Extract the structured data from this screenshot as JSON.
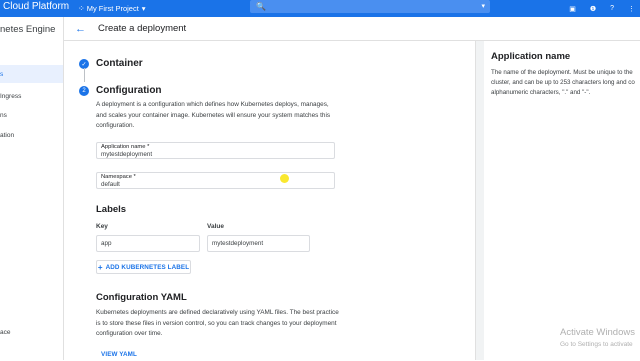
{
  "topbar": {
    "app_title": "Cloud Platform",
    "project_label": "My First Project",
    "icons": [
      "menu-icon",
      "project-dots-icon",
      "dropdown-icon",
      "search-icon",
      "search-dropdown-icon",
      "terminal-icon",
      "notifications-icon",
      "help-icon",
      "more-icon"
    ]
  },
  "sidebar": {
    "title": "netes Engine",
    "items": [
      {
        "label": "s",
        "active": true
      },
      {
        "label": "Ingress",
        "active": false
      },
      {
        "label": "ns",
        "active": false
      },
      {
        "label": "ation",
        "active": false
      },
      {
        "label": "ace",
        "active": false
      }
    ]
  },
  "header": {
    "title": "Create a deployment"
  },
  "steps": {
    "container": {
      "title": "Container"
    },
    "configuration": {
      "number": "2",
      "title": "Configuration",
      "description": "A deployment is a configuration which defines how Kubernetes deploys, manages, and scales your container image. Kubernetes will ensure your system matches this configuration.",
      "app_name": {
        "label": "Application name *",
        "value": "mytestdeployment"
      },
      "namespace": {
        "label": "Namespace *",
        "value": "default"
      }
    }
  },
  "labels": {
    "title": "Labels",
    "key_header": "Key",
    "value_header": "Value",
    "key": "app",
    "value": "mytestdeployment",
    "add_button": "ADD KUBERNETES LABEL"
  },
  "yaml": {
    "title": "Configuration YAML",
    "description": "Kubernetes deployments are defined declaratively using YAML files. The best practice is to store these files in version control, so you can track changes to your deployment configuration over time.",
    "view_button": "VIEW YAML"
  },
  "help_panel": {
    "title": "Application name",
    "description": "The name of the deployment. Must be unique to the cluster, and can be up to 253 characters long and co alphanumeric characters, \".\" and \"-\"."
  },
  "watermark": {
    "line1": "Activate Windows",
    "line2": "Go to Settings to activate"
  },
  "colors": {
    "primary": "#1a73e8",
    "accent_bg": "#e8f0fe"
  }
}
